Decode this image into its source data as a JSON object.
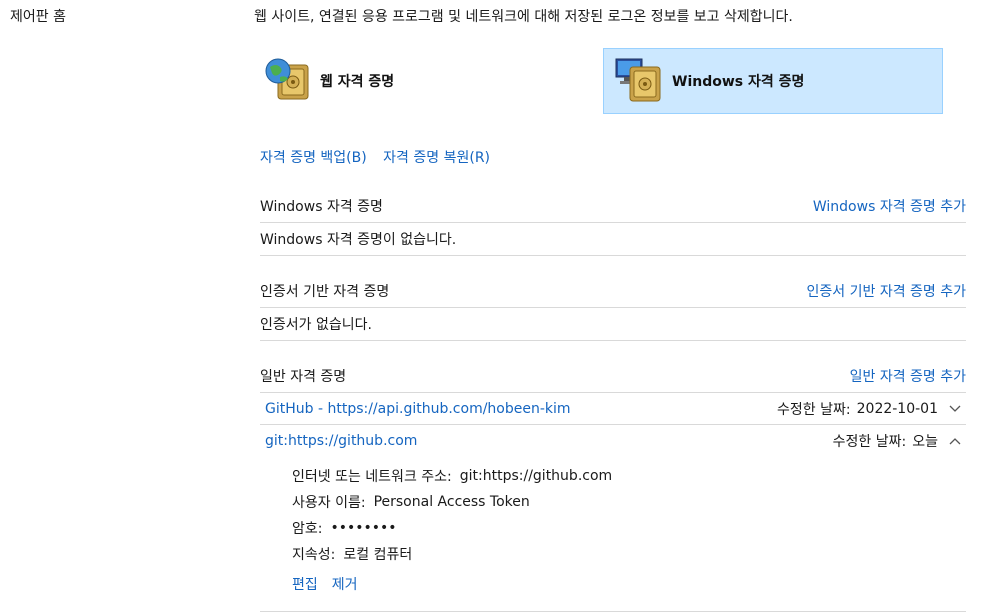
{
  "sidebar": {
    "home": "제어판 홈"
  },
  "description": "웹 사이트, 연결된 응용 프로그램 및 네트워크에 대해 저장된 로그온 정보를 보고 삭제합니다.",
  "tabs": {
    "web": "웹 자격 증명",
    "windows": "Windows 자격 증명"
  },
  "actions": {
    "backup": "자격 증명 백업(B)",
    "restore": "자격 증명 복원(R)"
  },
  "sections": {
    "windows": {
      "title": "Windows 자격 증명",
      "add": "Windows 자격 증명 추가",
      "empty": "Windows 자격 증명이 없습니다."
    },
    "cert": {
      "title": "인증서 기반 자격 증명",
      "add": "인증서 기반 자격 증명 추가",
      "empty": "인증서가 없습니다."
    },
    "generic": {
      "title": "일반 자격 증명",
      "add": "일반 자격 증명 추가"
    }
  },
  "credentials": [
    {
      "name": "GitHub - https://api.github.com/hobeen-kim",
      "modified_label": "수정한 날짜:",
      "modified_value": "2022-10-01",
      "expanded": false
    },
    {
      "name": "git:https://github.com",
      "modified_label": "수정한 날짜:",
      "modified_value": "오늘",
      "expanded": true
    }
  ],
  "detail": {
    "address_label": "인터넷 또는 네트워크 주소:",
    "address_value": "git:https://github.com",
    "user_label": "사용자 이름:",
    "user_value": "Personal Access Token",
    "password_label": "암호:",
    "password_value": "••••••••",
    "persistence_label": "지속성:",
    "persistence_value": "로컬 컴퓨터",
    "edit": "편집",
    "remove": "제거"
  },
  "icons": {
    "web": "globe-vault-icon",
    "windows": "computer-vault-icon",
    "chevron_down": "chevron-down-icon",
    "chevron_up": "chevron-up-icon"
  },
  "colors": {
    "link": "#1565c0",
    "selected_tile": "#cce8ff",
    "selected_border": "#99d1ff"
  }
}
